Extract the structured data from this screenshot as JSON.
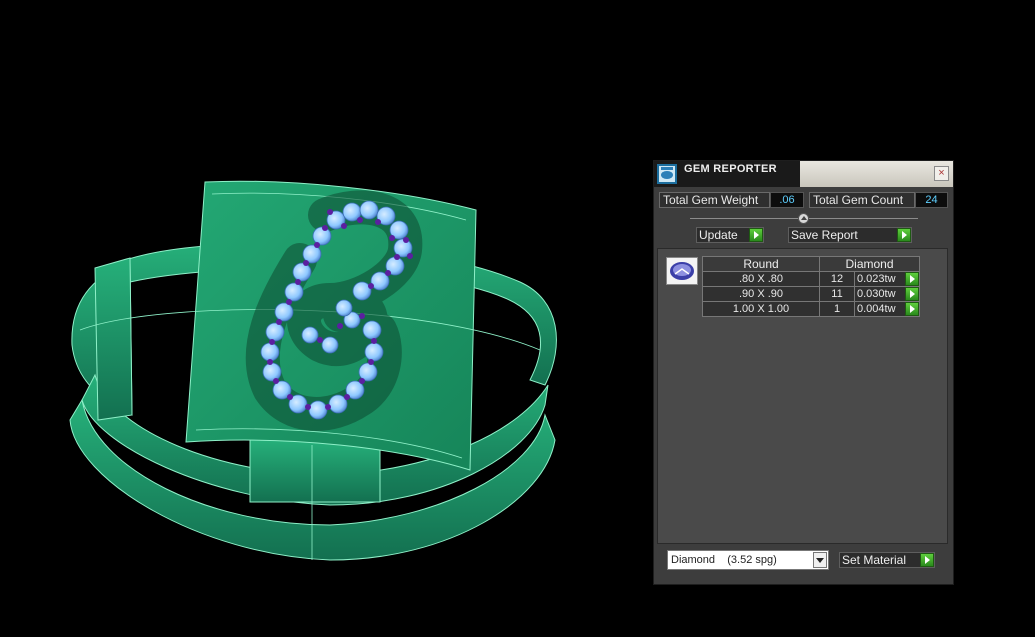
{
  "viewport": {
    "ring_color": "#1f9a6a",
    "ring_edge_color": "#9ef0cf",
    "gem_primary_color": "#8ec8ff",
    "gem_accent_color": "#5b1fa0"
  },
  "panel": {
    "title": "GEM REPORTER",
    "close_label": "×",
    "total_weight_label": "Total Gem Weight",
    "total_weight_value": ".06",
    "total_count_label": "Total Gem Count",
    "total_count_value": "24",
    "update_label": "Update",
    "save_report_label": "Save Report",
    "table": {
      "shape_header": "Round",
      "material_header": "Diamond",
      "rows": [
        {
          "size": ".80 X .80",
          "count": "12",
          "weight": "0.023tw"
        },
        {
          "size": ".90 X .90",
          "count": "11",
          "weight": "0.030tw"
        },
        {
          "size": "1.00 X 1.00",
          "count": "1",
          "weight": "0.004tw"
        }
      ]
    },
    "material_select": "Diamond    (3.52 spg)",
    "set_material_label": "Set Material",
    "accent_color": "#3aa82a"
  }
}
